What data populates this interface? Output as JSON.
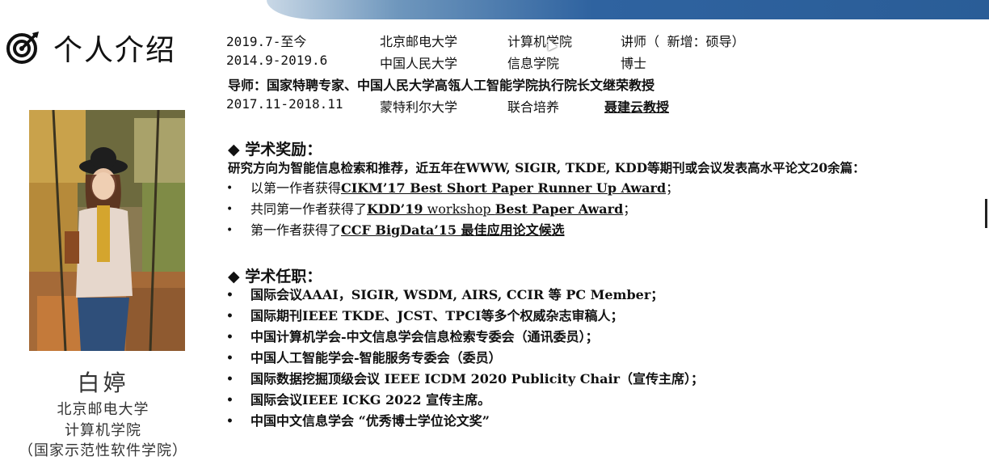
{
  "section_title": "个人介绍",
  "icon": "target-icon",
  "profile": {
    "name": "白婷",
    "school": "北京邮电大学",
    "college": "计算机学院",
    "college_alt": "（国家示范性软件学院）"
  },
  "education": [
    {
      "period": "2019.7-至今",
      "institution": "北京邮电大学",
      "department": "计算机学院",
      "title": "讲师（ 新增：硕导）"
    },
    {
      "period": "2014.9-2019.6",
      "institution": "中国人民大学",
      "department": "信息学院",
      "title": "博士"
    }
  ],
  "advisor": "导师：国家特聘专家、中国人民大学高瓴人工智能学院执行院长文继荣教授",
  "joint": {
    "period": "2017.11-2018.11",
    "institution": "蒙特利尔大学",
    "program": "联合培养",
    "supervisor": "聂建云教授"
  },
  "awards": {
    "heading": "◆ 学术奖励：",
    "intro": "研究方向为智能信息检索和推荐，近五年在WWW, SIGIR, TKDE, KDD等期刊或会议发表高水平论文20余篇：",
    "items": [
      {
        "prefix": "以第一作者获得",
        "award": "CIKM’17 Best Short Paper Runner Up Award",
        "suffix": "；"
      },
      {
        "prefix": "共同第一作者获得了",
        "award_a": "KDD’19",
        "award_b": " workshop ",
        "award_c": "Best Paper Award",
        "suffix": "；"
      },
      {
        "prefix": "第一作者获得了",
        "award": "CCF BigData’15 最佳应用论文候选",
        "suffix": ""
      }
    ]
  },
  "positions": {
    "heading": "◆ 学术任职：",
    "items": [
      "国际会议AAAI，SIGIR, WSDM, AIRS, CCIR 等 PC Member；",
      "国际期刊IEEE TKDE、JCST、TPCI等多个权威杂志审稿人；",
      "中国计算机学会-中文信息学会信息检索专委会（通讯委员）；",
      "中国人工智能学会-智能服务专委会（委员）",
      "国际数据挖掘顶级会议 IEEE ICDM 2020 Publicity Chair（宣传主席）；",
      "国际会议IEEE ICKG 2022  宣传主席。",
      "中国中文信息学会 “优秀博士学位论文奖”"
    ]
  },
  "bullet": "•",
  "colors": {
    "band": "#2f63a0",
    "text": "#111111"
  }
}
